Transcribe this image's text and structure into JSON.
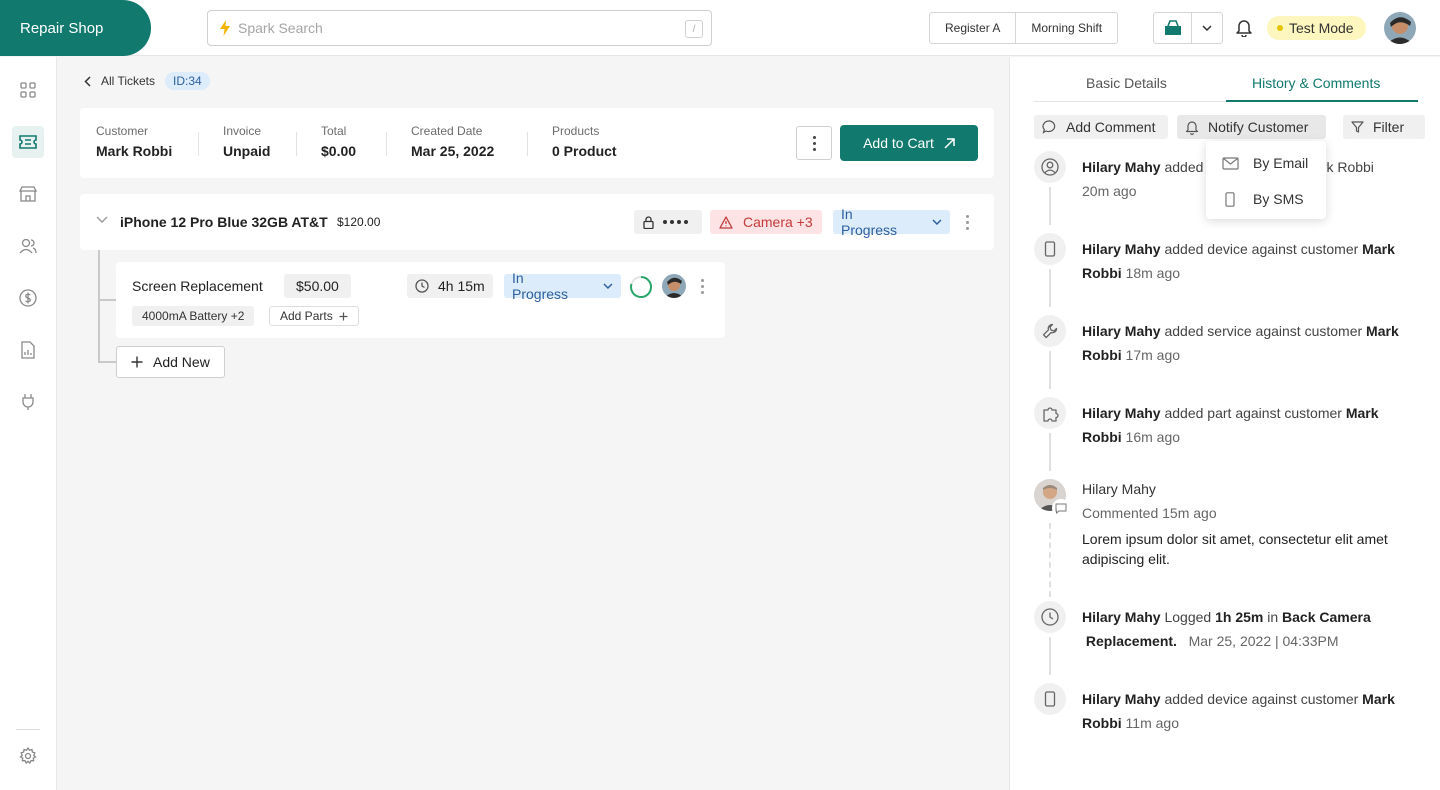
{
  "brand": {
    "name": "Repair Shop"
  },
  "search": {
    "placeholder": "Spark Search",
    "shortcut": "/"
  },
  "register": {
    "name": "Register A",
    "shift": "Morning Shift"
  },
  "test_mode": {
    "label": "Test Mode"
  },
  "sidebar": {
    "items": [
      {
        "name": "dashboard",
        "icon": "grid-icon"
      },
      {
        "name": "tickets",
        "icon": "ticket-icon",
        "active": true
      },
      {
        "name": "store",
        "icon": "store-icon"
      },
      {
        "name": "customers",
        "icon": "users-icon"
      },
      {
        "name": "sales",
        "icon": "dollar-icon"
      },
      {
        "name": "reports",
        "icon": "report-icon"
      },
      {
        "name": "integrations",
        "icon": "plug-icon"
      }
    ],
    "settings_icon": "gear-icon"
  },
  "breadcrumb": {
    "back_label": "All Tickets",
    "id": "ID:34"
  },
  "summary": {
    "customer_label": "Customer",
    "customer": "Mark Robbi",
    "invoice_label": "Invoice",
    "invoice": "Unpaid",
    "total_label": "Total",
    "total": "$0.00",
    "created_label": "Created Date",
    "created": "Mar 25, 2022",
    "products_label": "Products",
    "products": "0 Product",
    "add_to_cart": "Add to Cart"
  },
  "device": {
    "name": "iPhone 12 Pro Blue 32GB AT&T",
    "price": "$120.00",
    "issue": "Camera +3",
    "status": "In Progress"
  },
  "service": {
    "title": "Screen Replacement",
    "amount": "$50.00",
    "time": "4h 15m",
    "status": "In Progress",
    "part": "4000mA Battery +2",
    "add_parts": "Add Parts"
  },
  "add_new": "Add New",
  "panel": {
    "tabs": [
      "Basic Details",
      "History & Comments"
    ],
    "active_tab": "History & Comments",
    "actions": {
      "add_comment": "Add Comment",
      "notify_customer": "Notify Customer",
      "filter": "Filter"
    },
    "notify_menu": [
      "By Email",
      "By SMS"
    ],
    "history": [
      {
        "icon": "user-icon",
        "user": "Hilary Mahy",
        "action": "added customer",
        "target": "Mark Robbi",
        "visible_action": "added",
        "visible_target": "ark Robbi",
        "time": "20m ago"
      },
      {
        "icon": "phone-icon",
        "user": "Hilary Mahy",
        "action": "added device against customer",
        "target": "Mark",
        "target2": "Robbi",
        "time": "18m ago"
      },
      {
        "icon": "wrench-icon",
        "user": "Hilary Mahy",
        "action": "added service against customer",
        "target": "Mark",
        "target2": "Robbi",
        "time": "17m ago"
      },
      {
        "icon": "puzzle-icon",
        "user": "Hilary Mahy",
        "action": "added part against customer",
        "target": "Mark",
        "target2": "Robbi",
        "time": "16m ago"
      },
      {
        "icon": "avatar",
        "user": "Hilary Mahy",
        "action": "Commented 15m ago",
        "comment": "Lorem ipsum dolor sit amet, consectetur elit amet adipiscing elit."
      },
      {
        "icon": "clock-icon",
        "user": "Hilary Mahy",
        "action": "Logged",
        "duration": "1h 25m",
        "in": "in",
        "target": "Back Camera",
        "target2": "Replacement.",
        "time": "Mar 25, 2022 | 04:33PM"
      },
      {
        "icon": "phone-icon",
        "user": "Hilary Mahy",
        "action": "added device against customer",
        "target": "Mark",
        "target2": "Robbi",
        "time": "11m ago"
      }
    ]
  },
  "colors": {
    "brand": "#11796d",
    "status_blue": "#dcecfb",
    "danger_bg": "#fde3e3",
    "test_mode_bg": "#fdf6bf"
  }
}
